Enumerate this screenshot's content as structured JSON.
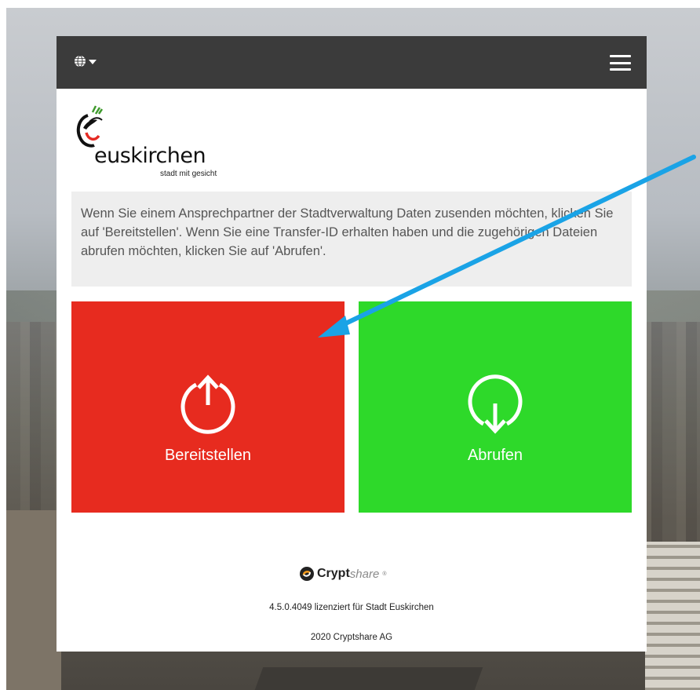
{
  "header": {
    "language_icon": "globe-icon",
    "menu_icon": "hamburger-menu-icon"
  },
  "logo": {
    "name": "euskirchen",
    "tagline": "stadt mit gesicht"
  },
  "info_text": "Wenn Sie einem Ansprechpartner der Stadtverwaltung Daten zusenden möchten, klicken Sie auf 'Bereitstellen'. Wenn Sie eine Transfer-ID erhalten haben und die zugehörigen Dateien abrufen möchten, klicken Sie auf 'Abrufen'.",
  "tiles": [
    {
      "label": "Bereitstellen",
      "icon": "upload-power-icon",
      "color": "#e72b1f"
    },
    {
      "label": "Abrufen",
      "icon": "download-power-icon",
      "color": "#2ed92a"
    }
  ],
  "footer": {
    "brand_bold": "Crypt",
    "brand_light": "share",
    "brand_mark": "®",
    "version": "4.5.0.4049 lizenziert für Stadt Euskirchen",
    "copyright": "2020 Cryptshare AG"
  },
  "annotation": {
    "arrow_color": "#1aa3e6"
  }
}
